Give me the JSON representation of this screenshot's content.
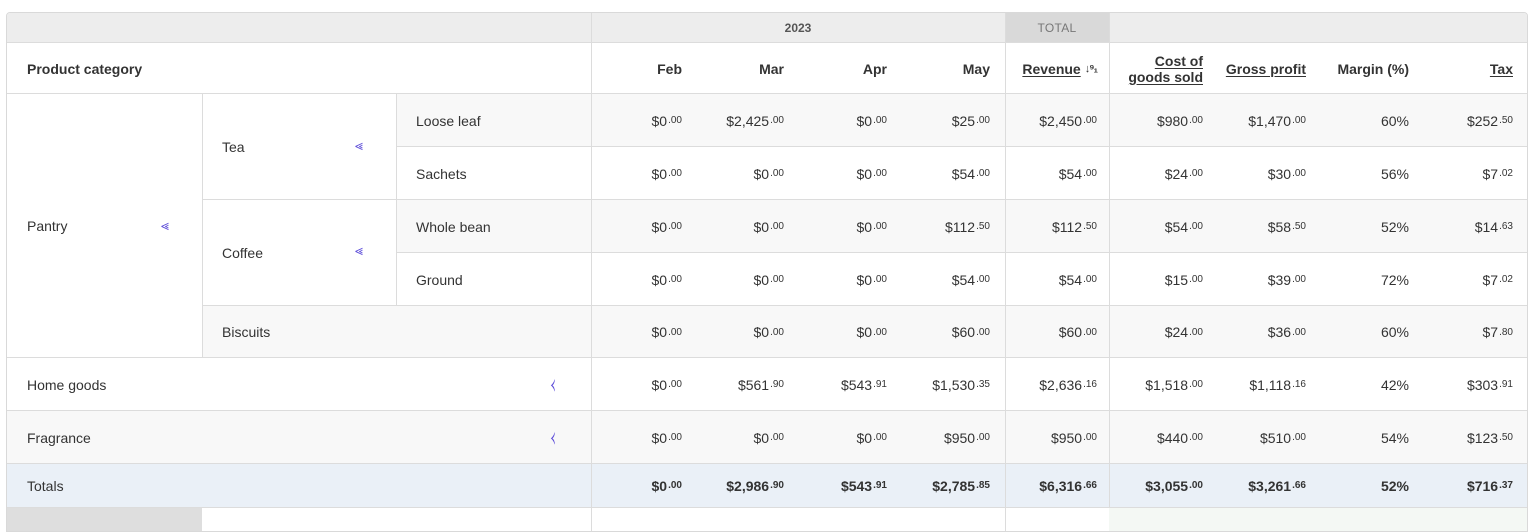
{
  "year_label": "2023",
  "total_label": "TOTAL",
  "headers": {
    "category": "Product category",
    "months": [
      "Feb",
      "Mar",
      "Apr",
      "May"
    ],
    "revenue": "Revenue",
    "revenue_sort_icon": "sort-ascending-icon",
    "cogs_line1": "Cost of",
    "cogs_line2": "goods sold",
    "gross_profit": "Gross profit",
    "margin": "Margin (%)",
    "tax": "Tax"
  },
  "groups": {
    "pantry": "Pantry",
    "tea": "Tea",
    "coffee": "Coffee",
    "biscuits": "Biscuits",
    "loose_leaf": "Loose leaf",
    "sachets": "Sachets",
    "whole_bean": "Whole bean",
    "ground": "Ground",
    "home_goods": "Home goods",
    "fragrance": "Fragrance",
    "totals": "Totals",
    "collapse_icon": "collapse-icon",
    "expand_icon": "expand-icon"
  },
  "rows": [
    {
      "key": "loose_leaf",
      "values": [
        [
          "$0",
          ".00"
        ],
        [
          "$2,425",
          ".00"
        ],
        [
          "$0",
          ".00"
        ],
        [
          "$25",
          ".00"
        ],
        [
          "$2,450",
          ".00"
        ],
        [
          "$980",
          ".00"
        ],
        [
          "$1,470",
          ".00"
        ],
        [
          "60%",
          ""
        ],
        [
          "$252",
          ".50"
        ]
      ]
    },
    {
      "key": "sachets",
      "values": [
        [
          "$0",
          ".00"
        ],
        [
          "$0",
          ".00"
        ],
        [
          "$0",
          ".00"
        ],
        [
          "$54",
          ".00"
        ],
        [
          "$54",
          ".00"
        ],
        [
          "$24",
          ".00"
        ],
        [
          "$30",
          ".00"
        ],
        [
          "56%",
          ""
        ],
        [
          "$7",
          ".02"
        ]
      ]
    },
    {
      "key": "whole_bean",
      "values": [
        [
          "$0",
          ".00"
        ],
        [
          "$0",
          ".00"
        ],
        [
          "$0",
          ".00"
        ],
        [
          "$112",
          ".50"
        ],
        [
          "$112",
          ".50"
        ],
        [
          "$54",
          ".00"
        ],
        [
          "$58",
          ".50"
        ],
        [
          "52%",
          ""
        ],
        [
          "$14",
          ".63"
        ]
      ]
    },
    {
      "key": "ground",
      "values": [
        [
          "$0",
          ".00"
        ],
        [
          "$0",
          ".00"
        ],
        [
          "$0",
          ".00"
        ],
        [
          "$54",
          ".00"
        ],
        [
          "$54",
          ".00"
        ],
        [
          "$15",
          ".00"
        ],
        [
          "$39",
          ".00"
        ],
        [
          "72%",
          ""
        ],
        [
          "$7",
          ".02"
        ]
      ]
    },
    {
      "key": "biscuits",
      "values": [
        [
          "$0",
          ".00"
        ],
        [
          "$0",
          ".00"
        ],
        [
          "$0",
          ".00"
        ],
        [
          "$60",
          ".00"
        ],
        [
          "$60",
          ".00"
        ],
        [
          "$24",
          ".00"
        ],
        [
          "$36",
          ".00"
        ],
        [
          "60%",
          ""
        ],
        [
          "$7",
          ".80"
        ]
      ]
    },
    {
      "key": "home_goods",
      "values": [
        [
          "$0",
          ".00"
        ],
        [
          "$561",
          ".90"
        ],
        [
          "$543",
          ".91"
        ],
        [
          "$1,530",
          ".35"
        ],
        [
          "$2,636",
          ".16"
        ],
        [
          "$1,518",
          ".00"
        ],
        [
          "$1,118",
          ".16"
        ],
        [
          "42%",
          ""
        ],
        [
          "$303",
          ".91"
        ]
      ]
    },
    {
      "key": "fragrance",
      "values": [
        [
          "$0",
          ".00"
        ],
        [
          "$0",
          ".00"
        ],
        [
          "$0",
          ".00"
        ],
        [
          "$950",
          ".00"
        ],
        [
          "$950",
          ".00"
        ],
        [
          "$440",
          ".00"
        ],
        [
          "$510",
          ".00"
        ],
        [
          "54%",
          ""
        ],
        [
          "$123",
          ".50"
        ]
      ]
    },
    {
      "key": "totals",
      "values": [
        [
          "$0",
          ".00"
        ],
        [
          "$2,986",
          ".90"
        ],
        [
          "$543",
          ".91"
        ],
        [
          "$2,785",
          ".85"
        ],
        [
          "$6,316",
          ".66"
        ],
        [
          "$3,055",
          ".00"
        ],
        [
          "$3,261",
          ".66"
        ],
        [
          "52%",
          ""
        ],
        [
          "$716",
          ".37"
        ]
      ]
    }
  ]
}
